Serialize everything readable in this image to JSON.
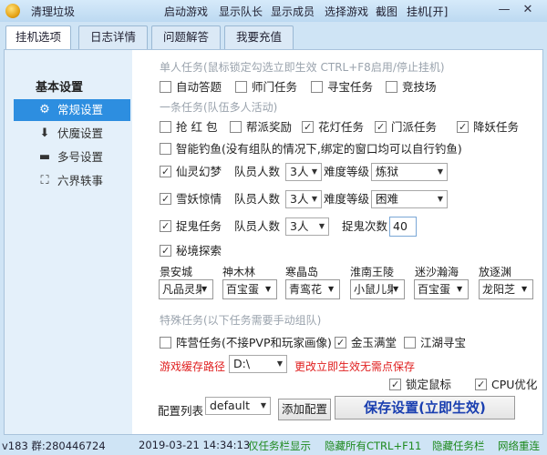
{
  "window": {
    "title": "清理垃圾",
    "menu": [
      "启动游戏",
      "显示队长",
      "显示成员",
      "选择游戏",
      "截图",
      "挂机[开]"
    ],
    "minimize": "—",
    "close": "✕"
  },
  "tabs": [
    "挂机选项",
    "日志详情",
    "问题解答",
    "我要充值"
  ],
  "sidebar": {
    "header": "基本设置",
    "items": [
      {
        "label": "常规设置",
        "icon": "gear-icon"
      },
      {
        "label": "伏魔设置",
        "icon": "download-icon"
      },
      {
        "label": "多号设置",
        "icon": "keyboard-icon"
      },
      {
        "label": "六界轶事",
        "icon": "expand-icon"
      }
    ]
  },
  "single_tasks": {
    "header": "单人任务(鼠标锁定勾选立即生效 CTRL+F8启用/停止挂机)",
    "items": [
      {
        "label": "自动答题",
        "checked": false
      },
      {
        "label": "师门任务",
        "checked": false
      },
      {
        "label": "寻宝任务",
        "checked": false
      },
      {
        "label": "竞技场",
        "checked": false
      }
    ]
  },
  "team_tasks": {
    "header": "一条任务(队伍多人活动)",
    "row1": [
      {
        "label": "抢 红 包",
        "checked": false
      },
      {
        "label": "帮派奖励",
        "checked": false
      },
      {
        "label": "花灯任务",
        "checked": true
      },
      {
        "label": "门派任务",
        "checked": true
      },
      {
        "label": "降妖任务",
        "checked": true
      }
    ],
    "fishing": {
      "label": "智能钓鱼(没有组队的情况下,绑定的窗口均可以自行钓鱼)",
      "checked": false
    },
    "dream": {
      "label": "仙灵幻梦",
      "checked": true,
      "team_label": "队员人数",
      "team_value": "3人",
      "diff_label": "难度等级",
      "diff_value": "炼狱"
    },
    "demon": {
      "label": "雪妖惊情",
      "checked": true,
      "team_label": "队员人数",
      "team_value": "3人",
      "diff_label": "难度等级",
      "diff_value": "困难"
    },
    "ghost": {
      "label": "捉鬼任务",
      "checked": true,
      "team_label": "队员人数",
      "team_value": "3人",
      "count_label": "捉鬼次数",
      "count_value": "40"
    },
    "explore": {
      "label": "秘境探索",
      "checked": true
    },
    "zones": [
      {
        "name": "景安城",
        "value": "凡品灵果"
      },
      {
        "name": "神木林",
        "value": "百宝蛋"
      },
      {
        "name": "寒晶岛",
        "value": "青鸾花"
      },
      {
        "name": "淮南王陵",
        "value": "小鼠儿果"
      },
      {
        "name": "迷沙瀚海",
        "value": "百宝蛋"
      },
      {
        "name": "放逐渊",
        "value": "龙阳芝"
      }
    ]
  },
  "special_tasks": {
    "header": "特殊任务(以下任务需要手动组队)",
    "items": [
      {
        "label": "阵营任务(不接PVP和玩家画像)",
        "checked": false
      },
      {
        "label": "金玉满堂",
        "checked": true
      },
      {
        "label": "江湖寻宝",
        "checked": false
      }
    ]
  },
  "cache": {
    "label": "游戏缓存路径",
    "value": "D:\\",
    "note": "更改立即生效无需点保存"
  },
  "options": [
    {
      "label": "锁定鼠标",
      "checked": true
    },
    {
      "label": "CPU优化",
      "checked": true
    }
  ],
  "config": {
    "label": "配置列表",
    "value": "default",
    "add_button": "添加配置",
    "save_button": "保存设置(立即生效)"
  },
  "status": {
    "version": "v183 群:280446724",
    "datetime": "2019-03-21 14:34:13",
    "items": [
      "仅任务栏显示",
      "隐藏所有CTRL+F11",
      "隐藏任务栏",
      "网络重连"
    ]
  },
  "colors": {
    "accent": "#2d8ee0",
    "status_green": "#1f8a1f",
    "warning_red": "#e02020",
    "save_text": "#1a3fb0"
  }
}
